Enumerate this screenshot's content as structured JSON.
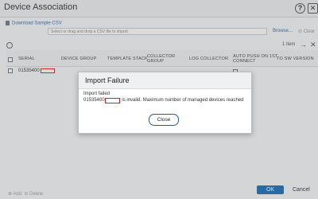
{
  "window": {
    "title": "Device Association",
    "help_icon": "?"
  },
  "upload": {
    "download_label": "Download Sample CSV",
    "file_placeholder": "Select or drag and drop a CSV file to import",
    "browse_label": "Browse...",
    "clear_label": "Clear"
  },
  "toolbar": {
    "item_count": "1 item"
  },
  "table": {
    "columns": [
      "SERIAL",
      "DEVICE GROUP",
      "TEMPLATE STACK",
      "COLLECTOR GROUP",
      "LOG COLLECTOR",
      "AUTO PUSH ON 1ST CONNECT",
      "TO SW VERSION"
    ],
    "rows": [
      {
        "serial": "01535400"
      }
    ]
  },
  "bottom": {
    "add_label": "Add",
    "delete_label": "Delete"
  },
  "footer": {
    "ok_label": "OK",
    "cancel_label": "Cancel"
  },
  "modal": {
    "title": "Import Failure",
    "line1": "Import failed",
    "serial_prefix": "01535400",
    "line2_suffix": "is invalid. Maximum number of managed devices reached",
    "close_label": "Close"
  }
}
